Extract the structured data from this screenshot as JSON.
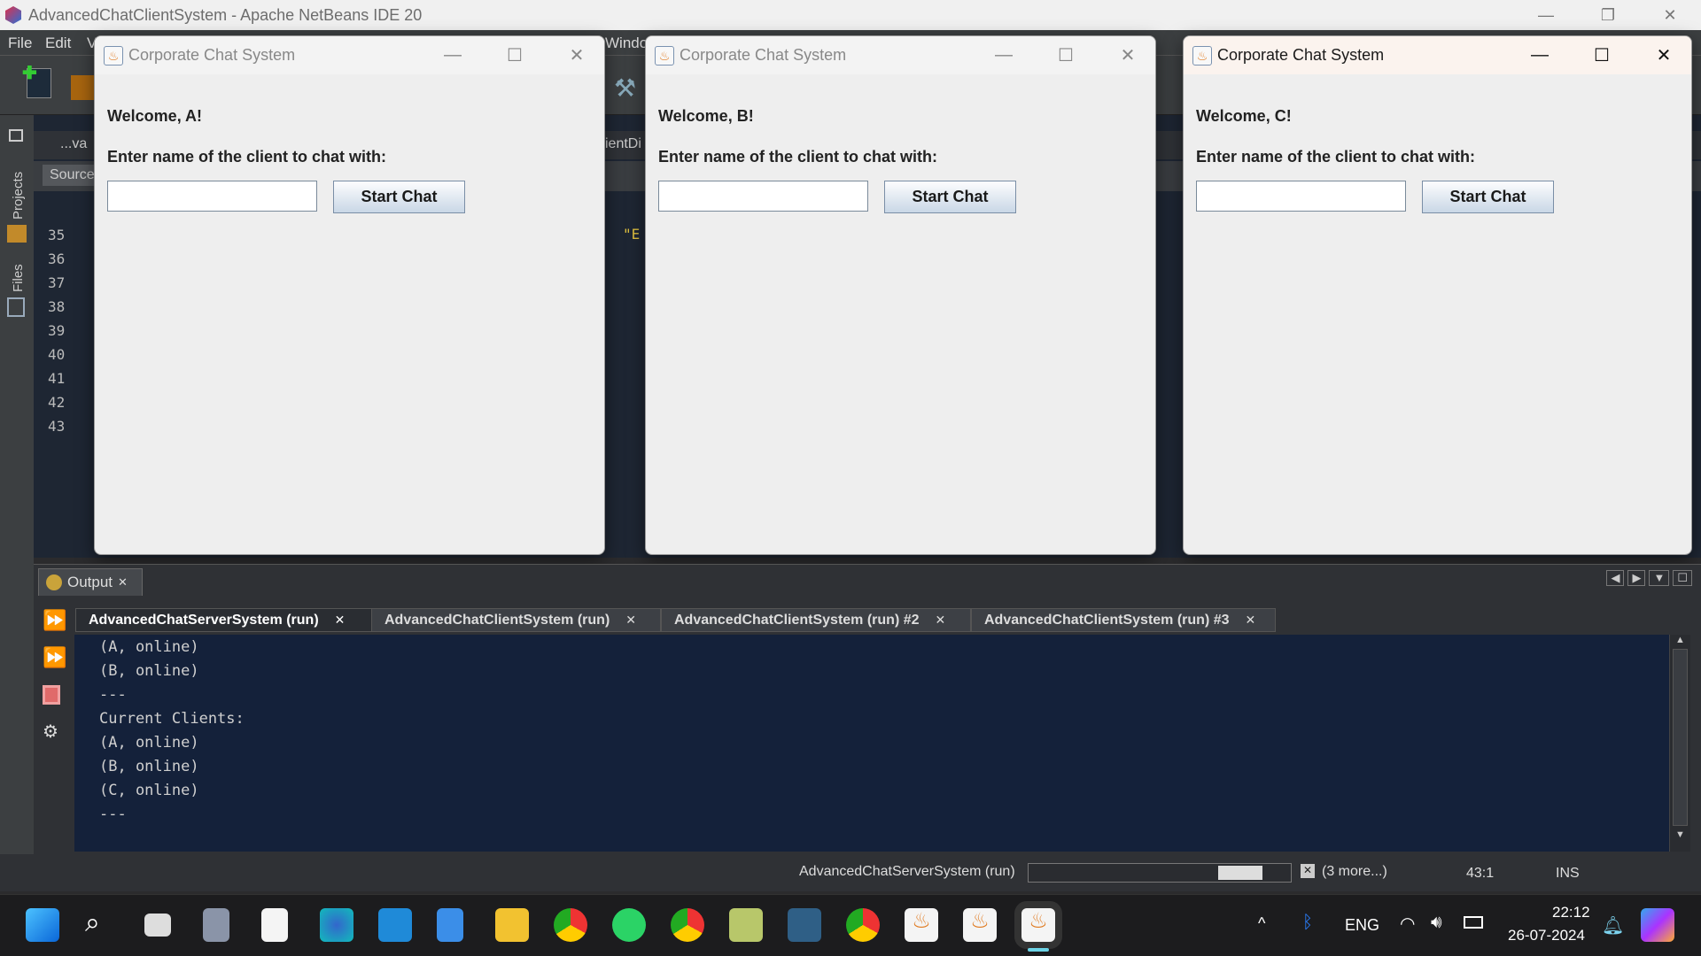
{
  "ide": {
    "title": "AdvancedChatClientSystem - Apache NetBeans IDE 20",
    "menu": [
      "File",
      "Edit",
      "V",
      "Window"
    ],
    "side_panels": [
      "Projects",
      "Files"
    ],
    "editor_tab": "...va",
    "editor_tab2": "ientDi",
    "source_tab": "Source",
    "code_snippet": "\"E",
    "line_numbers": [
      "35",
      "36",
      "37",
      "38",
      "39",
      "40",
      "41",
      "42",
      "43"
    ]
  },
  "dialogs": [
    {
      "title": "Corporate Chat System",
      "welcome": "Welcome, A!",
      "prompt": "Enter name of the client to chat with:",
      "input_value": "",
      "button": "Start Chat"
    },
    {
      "title": "Corporate Chat System",
      "welcome": "Welcome, B!",
      "prompt": "Enter name of the client to chat with:",
      "input_value": "",
      "button": "Start Chat"
    },
    {
      "title": "Corporate Chat System",
      "welcome": "Welcome, C!",
      "prompt": "Enter name of the client to chat with:",
      "input_value": "",
      "button": "Start Chat"
    }
  ],
  "output": {
    "title": "Output",
    "tabs": [
      "AdvancedChatServerSystem (run)",
      "AdvancedChatClientSystem (run)",
      "AdvancedChatClientSystem (run) #2",
      "AdvancedChatClientSystem (run) #3"
    ],
    "lines": [
      "(A, online)",
      "(B, online)",
      "---",
      "Current Clients:",
      "(A, online)",
      "(B, online)",
      "(C, online)",
      "---"
    ]
  },
  "status": {
    "task": "AdvancedChatServerSystem (run)",
    "more": "(3 more...)",
    "position": "43:1",
    "mode": "INS"
  },
  "tray": {
    "lang": "ENG",
    "time": "22:12",
    "date": "26-07-2024"
  },
  "colors": {
    "console_bg": "#14213a",
    "accent": "#2a6fd6"
  }
}
